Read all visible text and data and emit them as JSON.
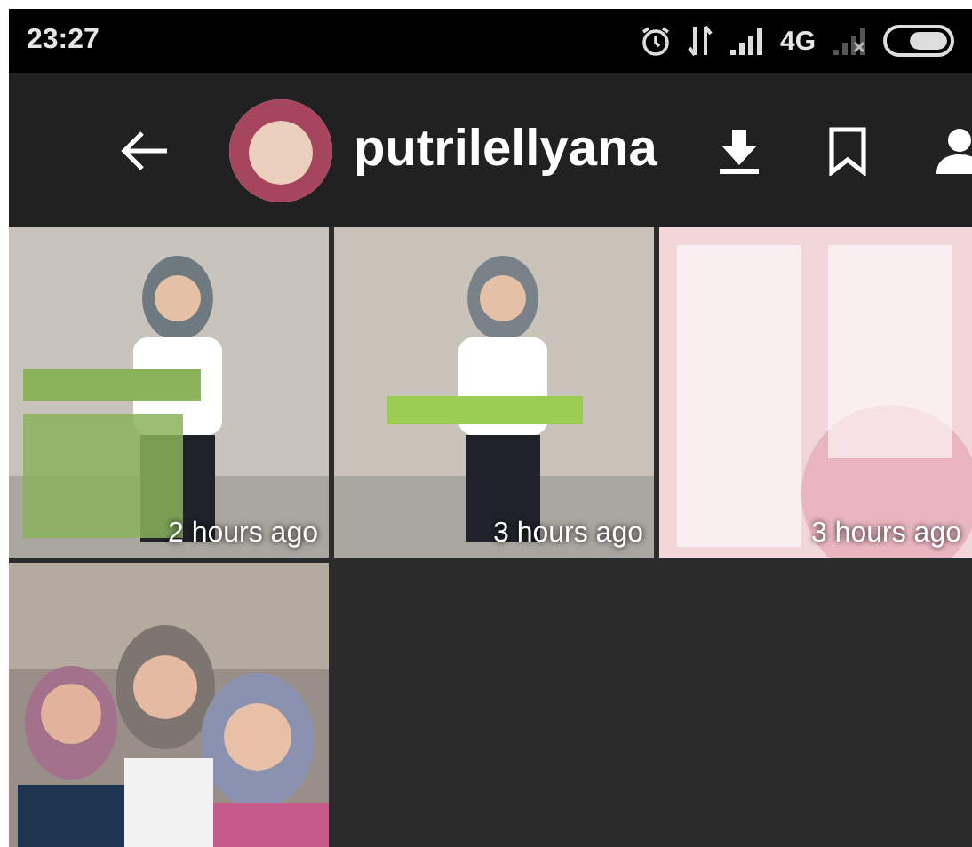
{
  "status_bar": {
    "time": "23:27",
    "network": "4G"
  },
  "app_bar": {
    "username": "putrilellyana"
  },
  "stories": [
    {
      "kind": "picture",
      "time": "2 hours ago"
    },
    {
      "kind": "picture",
      "time": "3 hours ago"
    },
    {
      "kind": "picture",
      "time": "3 hours ago"
    },
    {
      "kind": "picture"
    }
  ]
}
